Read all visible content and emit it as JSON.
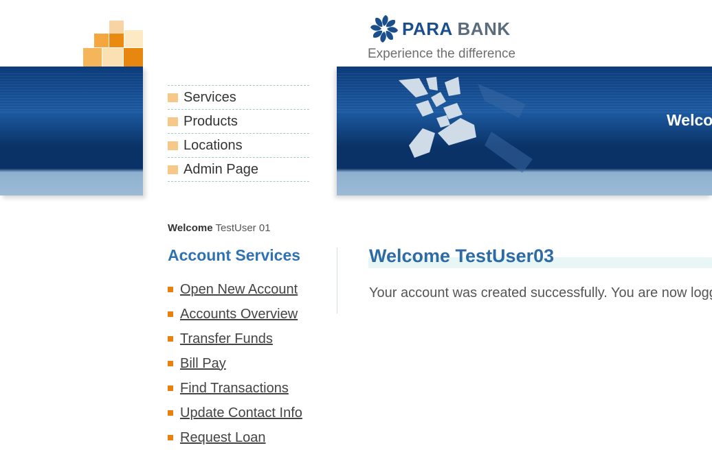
{
  "header": {
    "brand_para": "PARA",
    "brand_bank": "BANK",
    "tagline": "Experience the difference",
    "banner_text": "Welco"
  },
  "topnav": {
    "items": [
      {
        "label": "Services"
      },
      {
        "label": "Products"
      },
      {
        "label": "Locations"
      },
      {
        "label": "Admin Page"
      }
    ]
  },
  "sidebar": {
    "welcome_label": "Welcome",
    "welcome_user": "TestUser 01",
    "title": "Account Services",
    "links": [
      {
        "label": "Open New Account"
      },
      {
        "label": "Accounts Overview"
      },
      {
        "label": "Transfer Funds"
      },
      {
        "label": "Bill Pay"
      },
      {
        "label": "Find Transactions"
      },
      {
        "label": "Update Contact Info"
      },
      {
        "label": "Request Loan"
      }
    ]
  },
  "main": {
    "title": "Welcome TestUser03",
    "message": "Your account was created successfully. You are now logge"
  },
  "colors": {
    "accent_blue": "#2e72b2",
    "navy": "#0a3266",
    "orange": "#e8800e",
    "nav_bullet": "#f6c98b"
  }
}
